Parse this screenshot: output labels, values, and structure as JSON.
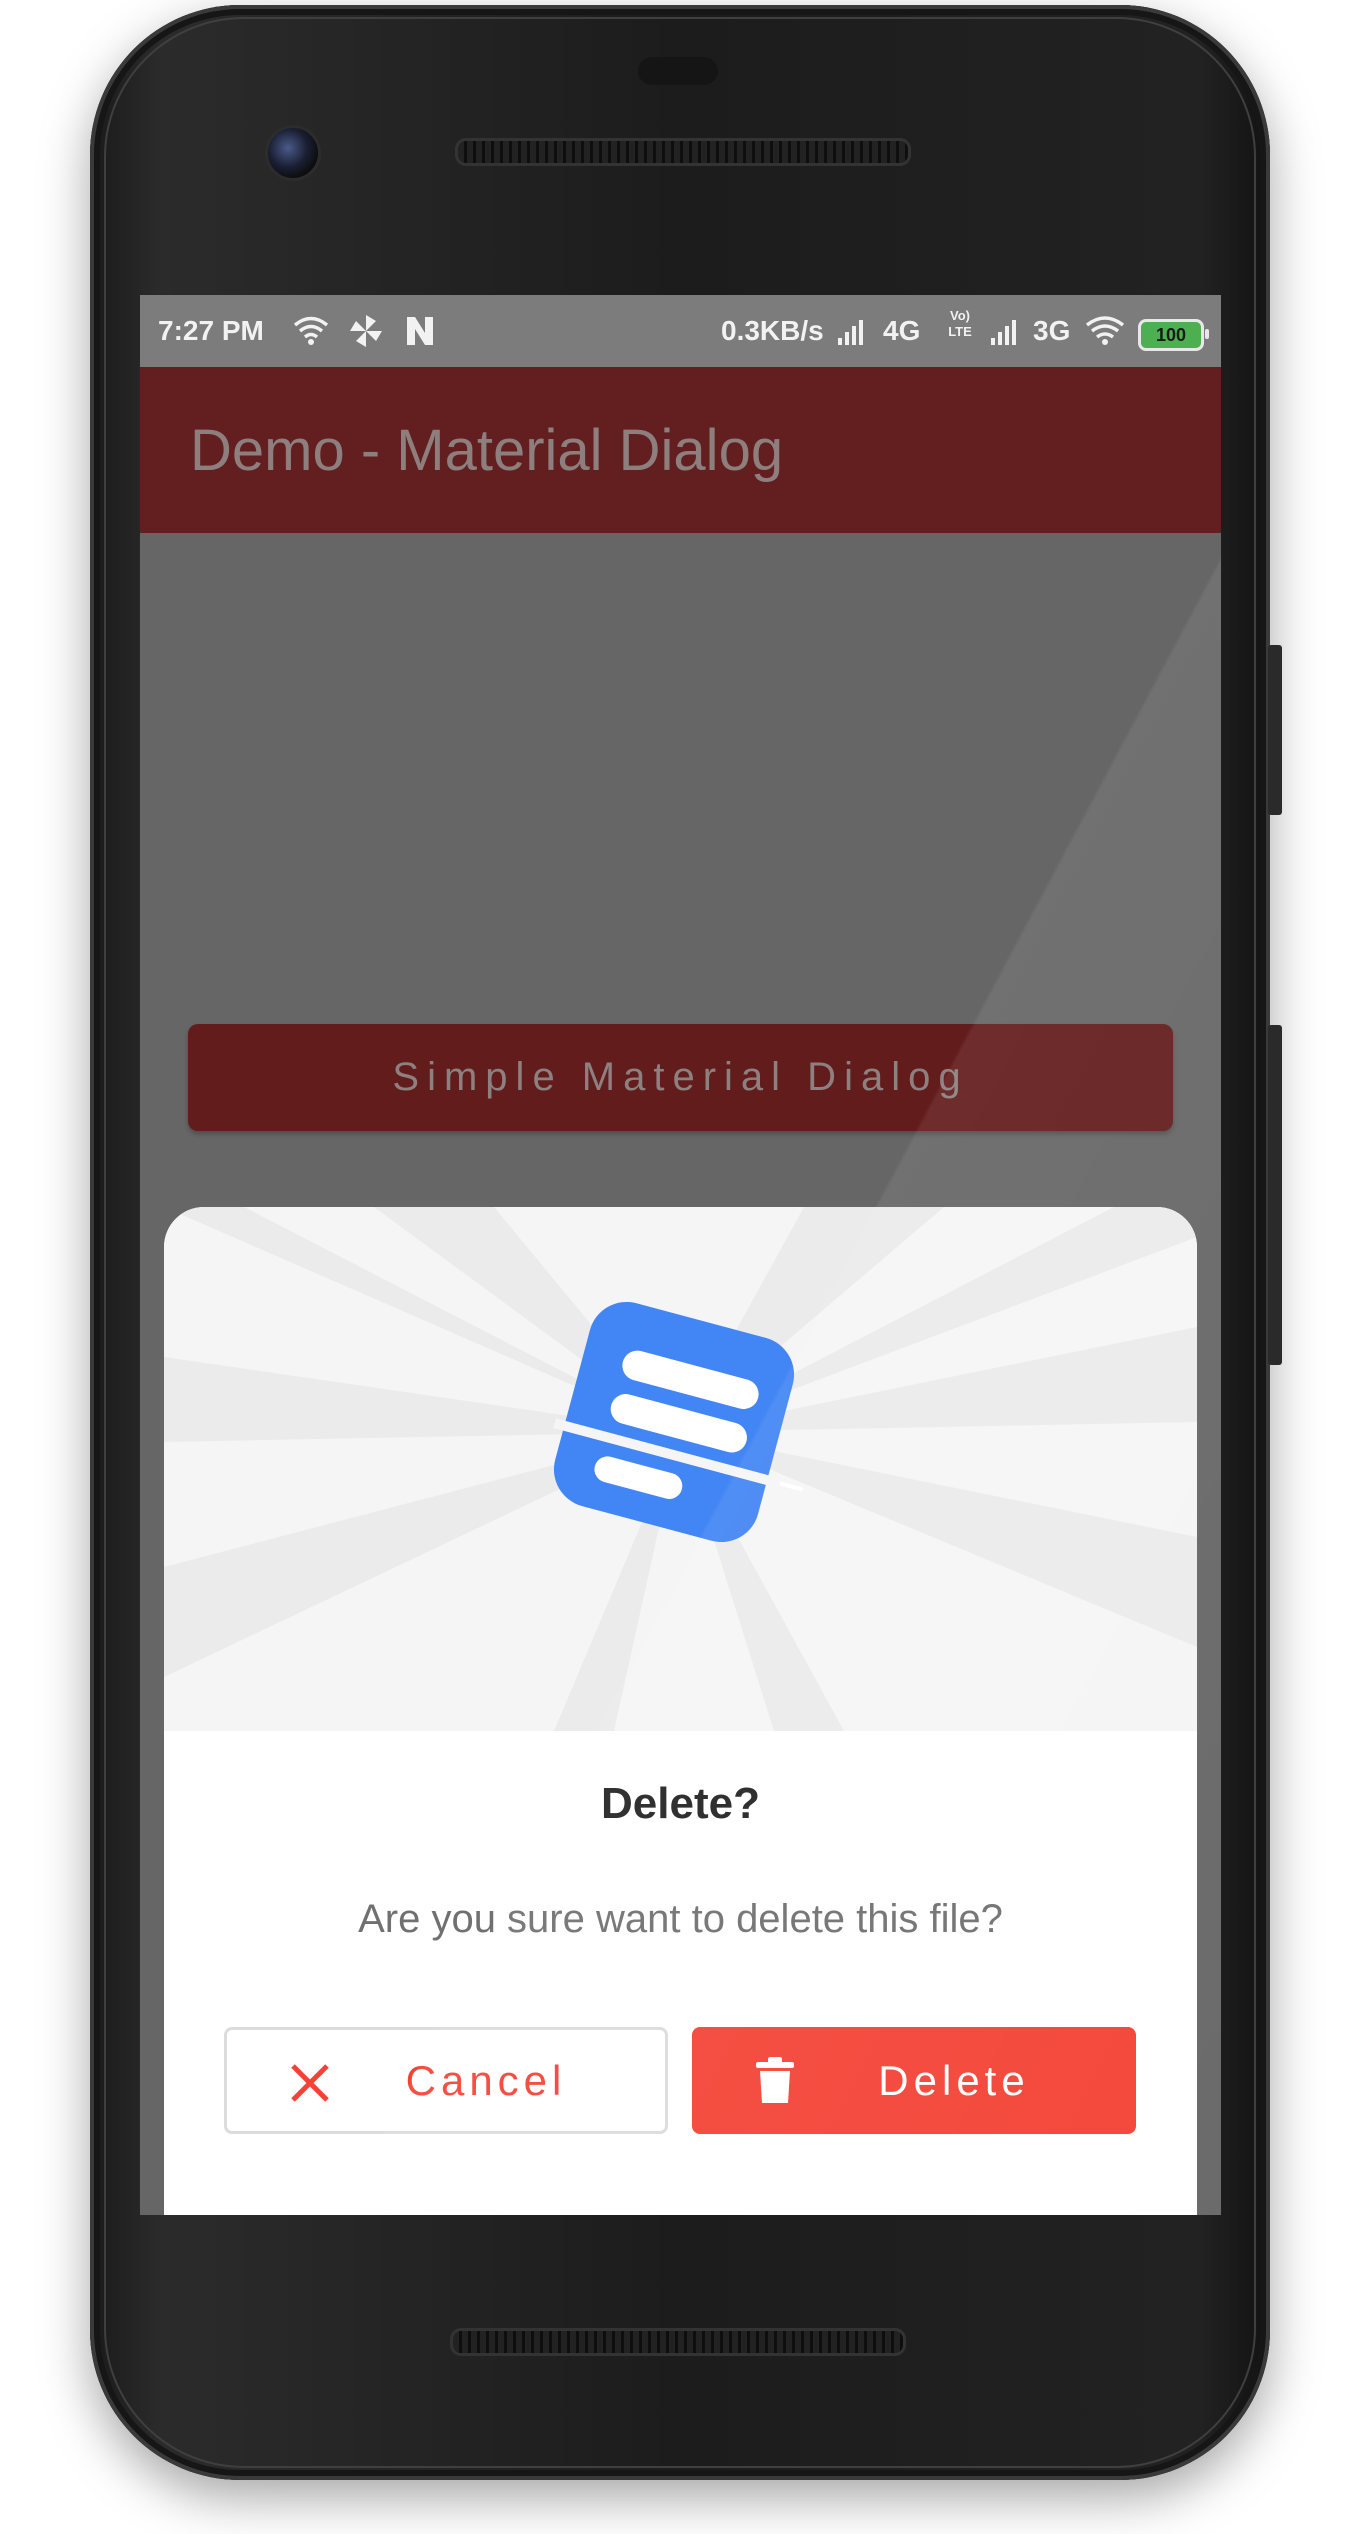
{
  "status_bar": {
    "time": "7:27 PM",
    "net_speed": "0.3KB/s",
    "network_1": "4G",
    "volte_top": "Vo)",
    "volte_bottom": "LTE",
    "network_2": "3G",
    "battery": "100",
    "icons": [
      "wifi-icon",
      "pinwheel-icon",
      "n-notification-icon",
      "signal-icon",
      "signal-icon",
      "wifi-icon",
      "battery-icon"
    ]
  },
  "app_bar": {
    "title": "Demo - Material Dialog"
  },
  "main": {
    "button_label": "Simple Material Dialog"
  },
  "dialog": {
    "title": "Delete?",
    "message": "Are you sure want to delete this file?",
    "cancel_label": "Cancel",
    "delete_label": "Delete",
    "hero_icon": "document-logo-icon"
  },
  "colors": {
    "accent": "#f44336",
    "app_bar": "#631f1f",
    "dim_overlay": "#666666",
    "logo_blue": "#4285f4"
  }
}
